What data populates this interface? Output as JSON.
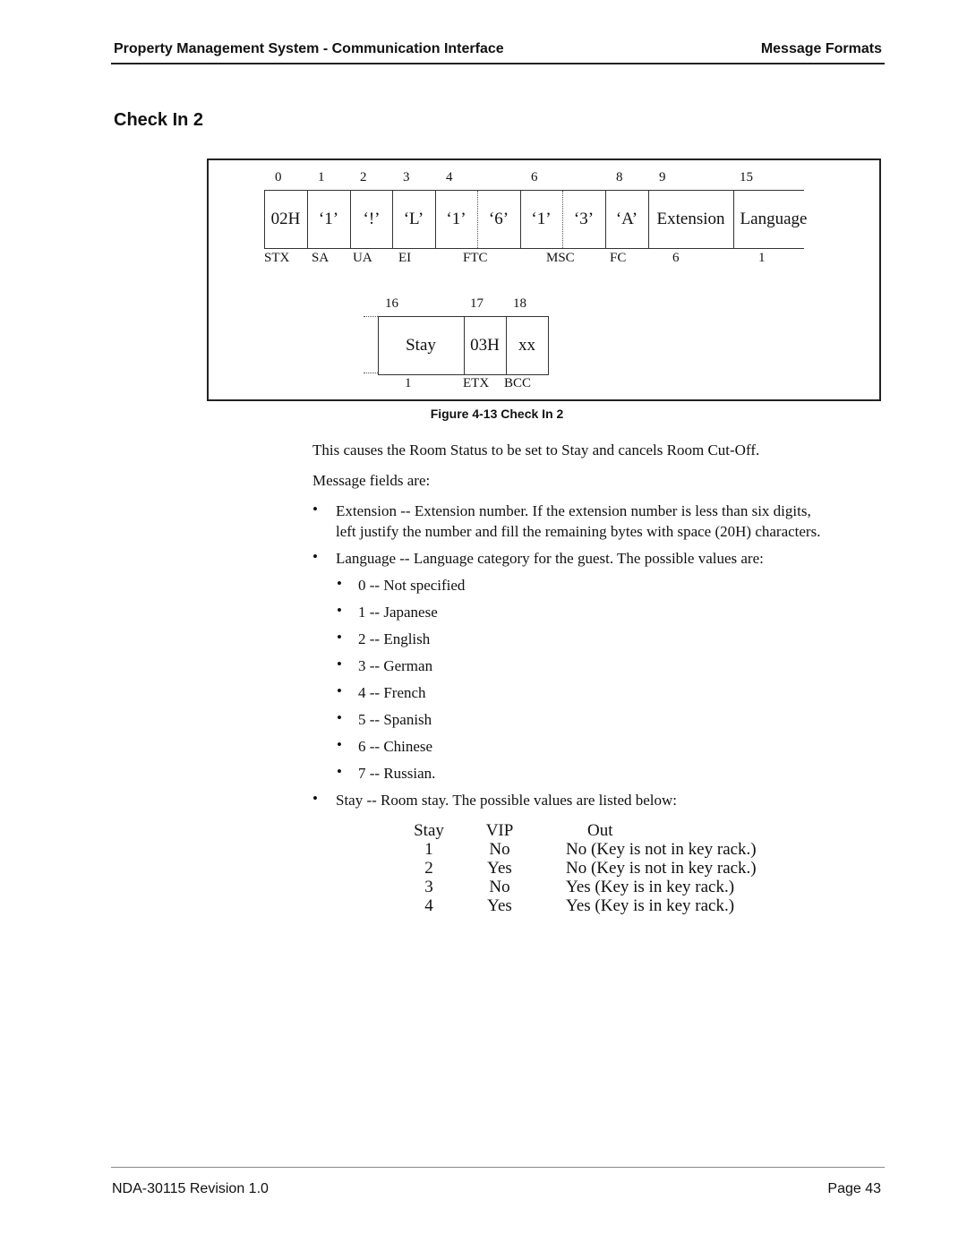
{
  "header": {
    "left": "Property Management System - Communication Interface",
    "right": "Message Formats"
  },
  "title": "Check In 2",
  "figure": {
    "row1": {
      "indices": [
        "0",
        "1",
        "2",
        "3",
        "4",
        "6",
        "8",
        "9",
        "15"
      ],
      "cells": [
        "02H",
        "‘1’",
        "‘!’",
        "‘L’",
        "‘1’",
        "‘6’",
        "‘1’",
        "‘3’",
        "‘A’",
        "Extension",
        "Language"
      ],
      "labels": [
        "STX",
        "SA",
        "UA",
        "EI",
        "FTC",
        "MSC",
        "FC",
        "6",
        "1"
      ]
    },
    "row2": {
      "indices": [
        "16",
        "17",
        "18"
      ],
      "cells": [
        "Stay",
        "03H",
        "xx"
      ],
      "labels": [
        "1",
        "ETX",
        "BCC"
      ]
    },
    "caption": "Figure 4-13   Check In 2"
  },
  "body": {
    "intro": "This causes the Room Status to be set to Stay and cancels Room Cut-Off.",
    "fields_intro": "Message fields are:",
    "bullet_char": "•",
    "extension_line1": "Extension -- Extension number. If the extension number is less than six digits,",
    "extension_line2": "left justify the number and fill the remaining bytes with space (20H) characters.",
    "language": "Language -- Language category for the guest. The possible values are:",
    "languages": [
      "0 -- Not specified",
      "1 -- Japanese",
      "2 -- English",
      "3 -- German",
      "4 -- French",
      "5 -- Spanish",
      "6 -- Chinese",
      "7 -- Russian."
    ],
    "stay": "Stay -- Room stay. The possible values are listed below:"
  },
  "stay_table": {
    "headers": [
      "Stay",
      "VIP",
      "Out"
    ],
    "rows": [
      [
        "1",
        "No",
        "No (Key is not in key rack.)"
      ],
      [
        "2",
        "Yes",
        "No (Key is not in key rack.)"
      ],
      [
        "3",
        "No",
        "Yes (Key is in key rack.)"
      ],
      [
        "4",
        "Yes",
        "Yes (Key is in key rack.)"
      ]
    ]
  },
  "footer": {
    "left": "NDA-30115  Revision 1.0",
    "right": "Page 43"
  }
}
